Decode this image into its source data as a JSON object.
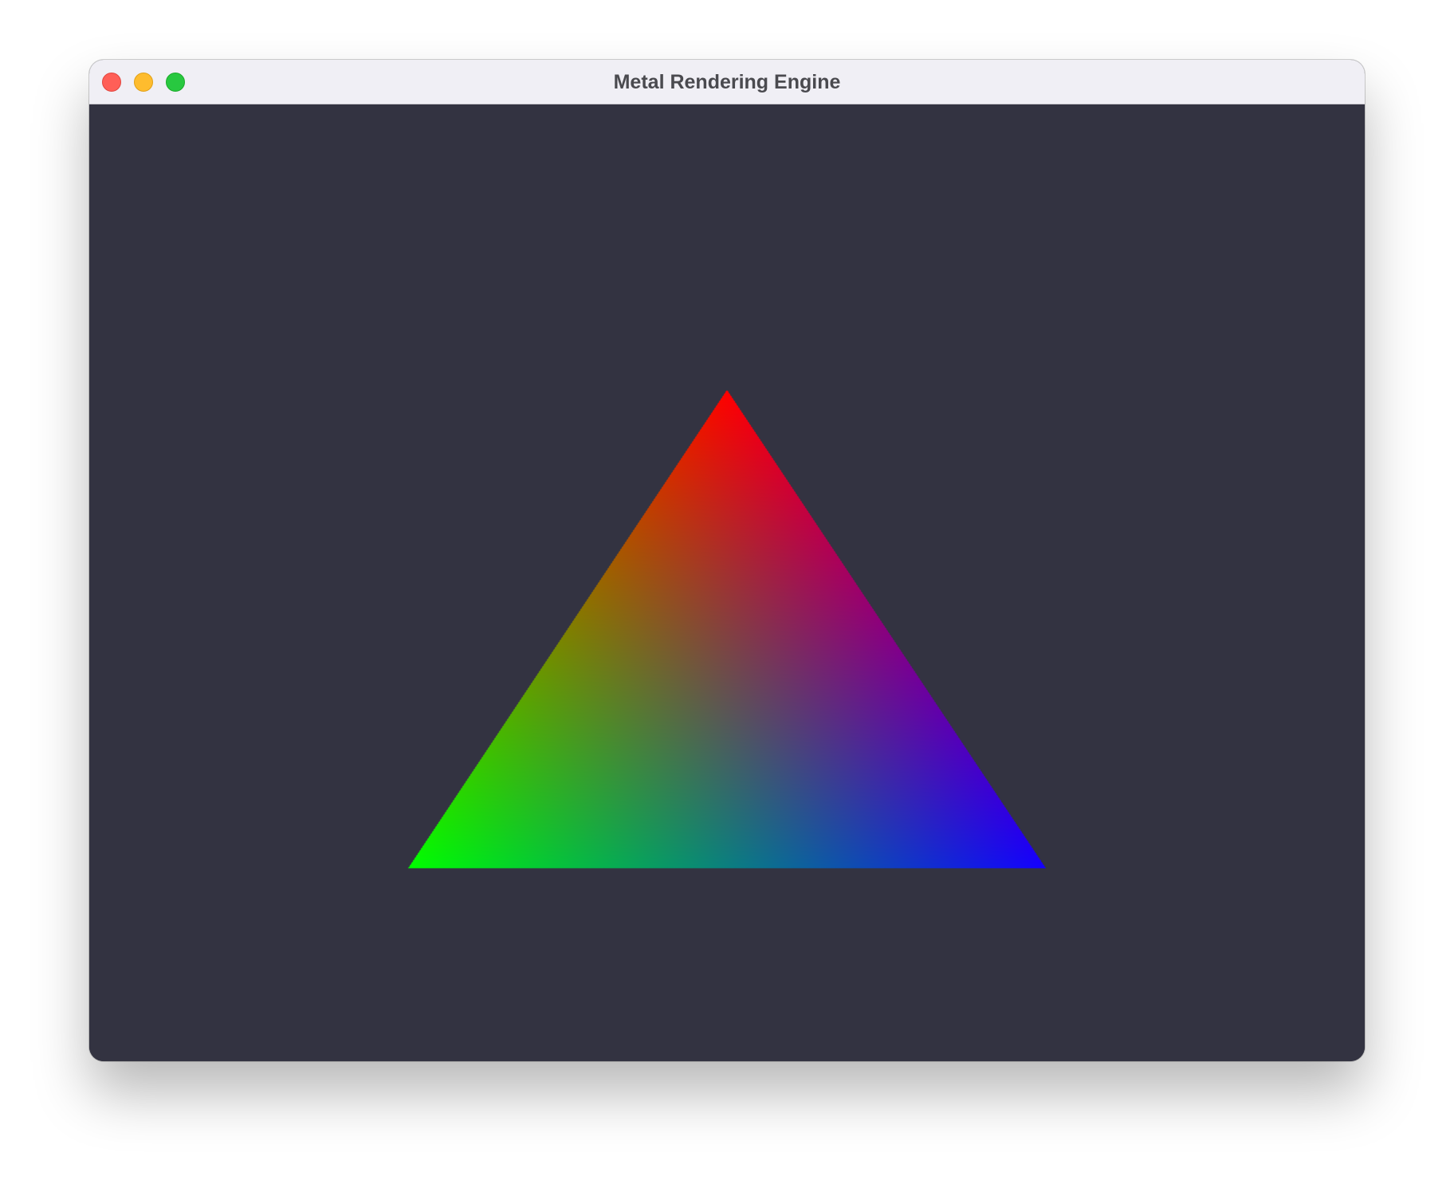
{
  "window": {
    "title": "Metal Rendering Engine"
  },
  "titlebar": {
    "close_icon": "close-icon",
    "minimize_icon": "minimize-icon",
    "zoom_icon": "zoom-icon"
  },
  "viewport": {
    "clear_color": "#333341",
    "triangle": {
      "top_vertex_color": "#ff0000",
      "left_vertex_color": "#00ff00",
      "right_vertex_color": "#1400ff"
    }
  }
}
